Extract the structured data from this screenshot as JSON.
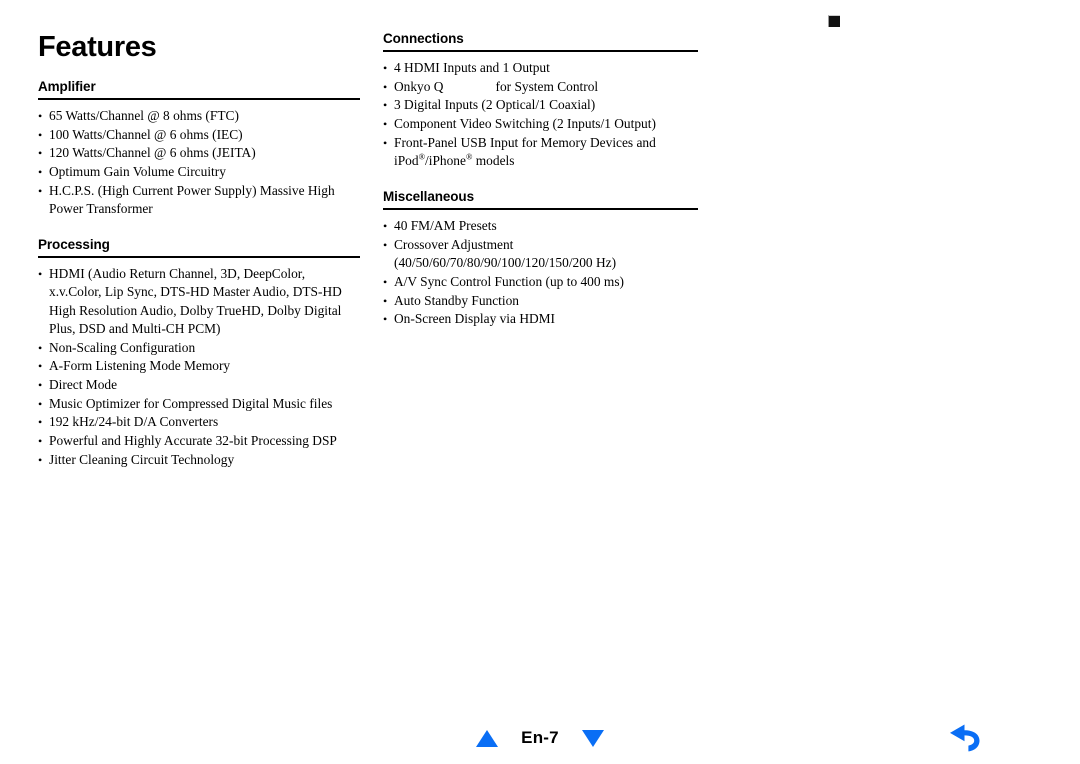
{
  "document": {
    "title": "Features",
    "page_label": "En-7"
  },
  "markers": {
    "corner_square": "corner-registration-mark",
    "back_arrow_icon": "back-arrow-icon",
    "prev_page_icon": "triangle-up-icon",
    "next_page_icon": "triangle-down-icon"
  },
  "colors": {
    "accent_blue": "#0a6ef5",
    "text": "#000000",
    "rule": "#000000"
  },
  "left_column": {
    "sections": [
      {
        "heading": "Amplifier",
        "items": [
          {
            "text": "65 Watts/Channel @ 8 ohms (FTC)"
          },
          {
            "text": "100 Watts/Channel @ 6 ohms (IEC)"
          },
          {
            "text": "120 Watts/Channel @ 6 ohms (JEITA)"
          },
          {
            "text": "Optimum Gain Volume Circuitry"
          },
          {
            "text": "H.C.P.S. (High Current Power Supply) Massive High",
            "cont": "Power Transformer"
          }
        ]
      },
      {
        "heading": "Processing",
        "items": [
          {
            "text": "HDMI (Audio Return Channel, 3D, DeepColor,",
            "cont": "x.v.Color, Lip Sync, DTS-HD Master Audio, DTS-HD High Resolution Audio, Dolby TrueHD, Dolby Digital Plus, DSD and Multi-CH PCM)"
          },
          {
            "text": "Non-Scaling Configuration"
          },
          {
            "text": "A-Form Listening Mode Memory"
          },
          {
            "text": "Direct Mode"
          },
          {
            "text": "Music Optimizer for Compressed Digital Music files"
          },
          {
            "text": "192 kHz/24-bit D/A Converters"
          },
          {
            "text": "Powerful and Highly Accurate 32-bit Processing DSP"
          },
          {
            "text": "Jitter Cleaning Circuit Technology"
          }
        ]
      }
    ]
  },
  "right_column": {
    "sections": [
      {
        "heading": "Connections",
        "items": [
          {
            "text": "4 HDMI Inputs and 1 Output"
          },
          {
            "prefix": "Onkyo  Q",
            "suffix": "for System Control",
            "has_logo_gap": true
          },
          {
            "text": "3 Digital Inputs (2 Optical/1 Coaxial)"
          },
          {
            "text": "Component Video Switching (2 Inputs/1 Output)"
          },
          {
            "text": "Front-Panel USB Input for Memory Devices and",
            "cont_html": "ipod_iphone"
          }
        ]
      },
      {
        "heading": "Miscellaneous",
        "items": [
          {
            "text": "40 FM/AM Presets"
          },
          {
            "text": "Crossover Adjustment",
            "cont": "(40/50/60/70/80/90/100/120/150/200 Hz)"
          },
          {
            "text": "A/V Sync Control Function (up to 400 ms)"
          },
          {
            "text": "Auto Standby Function"
          },
          {
            "text": "On-Screen Display via HDMI"
          }
        ]
      }
    ],
    "ipod_line": {
      "part1": "iPod",
      "reg1": "®",
      "part2": "/iPhone",
      "reg2": "®",
      "part3": " models"
    }
  }
}
